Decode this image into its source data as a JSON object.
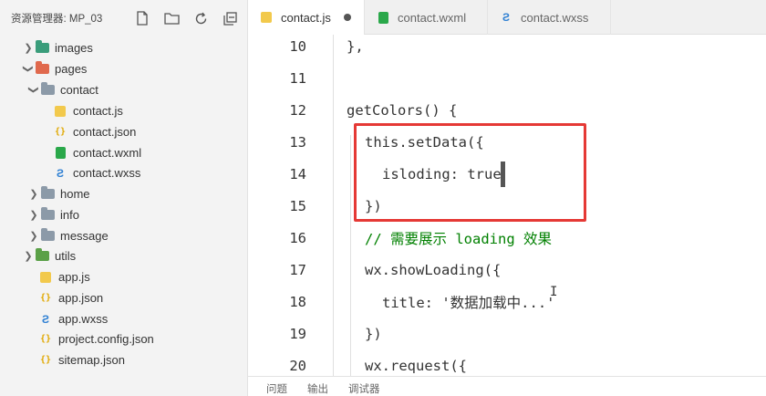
{
  "sidebar": {
    "title": "资源管理器: MP_03",
    "header_icons": [
      "new-file-icon",
      "new-folder-icon",
      "refresh-icon",
      "collapse-all-icon"
    ],
    "tree": [
      {
        "label": "images",
        "type": "folder",
        "expanded": false,
        "color": "#3a9d7b"
      },
      {
        "label": "pages",
        "type": "folder",
        "expanded": true,
        "color": "#e0694d"
      },
      {
        "label": "contact",
        "type": "folder",
        "expanded": true,
        "color": "#8c9aa8"
      },
      {
        "label": "contact.js",
        "type": "js"
      },
      {
        "label": "contact.json",
        "type": "json"
      },
      {
        "label": "contact.wxml",
        "type": "wxml"
      },
      {
        "label": "contact.wxss",
        "type": "wxss"
      },
      {
        "label": "home",
        "type": "folder",
        "expanded": false,
        "color": "#8c9aa8"
      },
      {
        "label": "info",
        "type": "folder",
        "expanded": false,
        "color": "#8c9aa8"
      },
      {
        "label": "message",
        "type": "folder",
        "expanded": false,
        "color": "#8c9aa8"
      },
      {
        "label": "utils",
        "type": "folder",
        "expanded": false,
        "color": "#5aa047"
      },
      {
        "label": "app.js",
        "type": "js"
      },
      {
        "label": "app.json",
        "type": "json"
      },
      {
        "label": "app.wxss",
        "type": "wxss"
      },
      {
        "label": "project.config.json",
        "type": "json"
      },
      {
        "label": "sitemap.json",
        "type": "json"
      }
    ]
  },
  "tabs": [
    {
      "label": "contact.js",
      "icon": "js",
      "active": true,
      "modified": true
    },
    {
      "label": "contact.wxml",
      "icon": "wxml",
      "active": false
    },
    {
      "label": "contact.wxss",
      "icon": "wxss",
      "active": false
    }
  ],
  "editor": {
    "lines": [
      {
        "num": "10",
        "text": "},"
      },
      {
        "num": "11",
        "text": ""
      },
      {
        "num": "12",
        "text": "getColors() {"
      },
      {
        "num": "13",
        "text": "this.setData({"
      },
      {
        "num": "14",
        "text": "isloding: true"
      },
      {
        "num": "15",
        "text": "})"
      },
      {
        "num": "16",
        "text": "// 需要展示 loading 效果"
      },
      {
        "num": "17",
        "text": "wx.showLoading({"
      },
      {
        "num": "18",
        "text": "title: '数据加载中...'"
      },
      {
        "num": "19",
        "text": "})"
      },
      {
        "num": "20",
        "text": "wx.request({"
      }
    ]
  },
  "panel_tabs": [
    "问题",
    "输出",
    "调试器"
  ],
  "colors": {
    "highlight_box": "#e53935",
    "keyword": "#0000cc",
    "comment": "#008000",
    "string": "#a31515"
  }
}
